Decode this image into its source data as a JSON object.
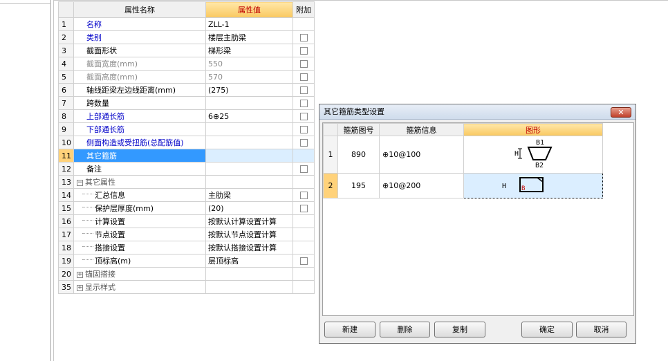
{
  "property_grid": {
    "headers": {
      "index": "",
      "name": "属性名称",
      "value": "属性值",
      "add": "附加"
    },
    "rows": [
      {
        "idx": "1",
        "name": "名称",
        "value": "ZLL-1",
        "check": false,
        "style": "blue"
      },
      {
        "idx": "2",
        "name": "类别",
        "value": "楼层主肋梁",
        "check": true,
        "style": "blue"
      },
      {
        "idx": "3",
        "name": "截面形状",
        "value": "梯形梁",
        "check": true,
        "style": "normal"
      },
      {
        "idx": "4",
        "name": "截面宽度(mm)",
        "value": "550",
        "check": true,
        "style": "gray"
      },
      {
        "idx": "5",
        "name": "截面高度(mm)",
        "value": "570",
        "check": true,
        "style": "gray"
      },
      {
        "idx": "6",
        "name": "轴线距梁左边线距离(mm)",
        "value": "(275)",
        "check": true,
        "style": "normal"
      },
      {
        "idx": "7",
        "name": "跨数量",
        "value": "",
        "check": true,
        "style": "normal"
      },
      {
        "idx": "8",
        "name": "上部通长筋",
        "value": "6⊕25",
        "check": true,
        "style": "blue"
      },
      {
        "idx": "9",
        "name": "下部通长筋",
        "value": "",
        "check": true,
        "style": "blue"
      },
      {
        "idx": "10",
        "name": "侧面构造或受扭筋(总配筋值)",
        "value": "",
        "check": true,
        "style": "blue"
      },
      {
        "idx": "11",
        "name": "其它箍筋",
        "value": "",
        "check": false,
        "style": "sel"
      },
      {
        "idx": "12",
        "name": "备注",
        "value": "",
        "check": true,
        "style": "normal"
      },
      {
        "idx": "13",
        "name": "其它属性",
        "value": "",
        "check": false,
        "style": "group",
        "expander": "−"
      },
      {
        "idx": "14",
        "name": "汇总信息",
        "value": "主肋梁",
        "check": true,
        "style": "child"
      },
      {
        "idx": "15",
        "name": "保护层厚度(mm)",
        "value": "(20)",
        "check": true,
        "style": "child"
      },
      {
        "idx": "16",
        "name": "计算设置",
        "value": "按默认计算设置计算",
        "check": false,
        "style": "child"
      },
      {
        "idx": "17",
        "name": "节点设置",
        "value": "按默认节点设置计算",
        "check": false,
        "style": "child"
      },
      {
        "idx": "18",
        "name": "搭接设置",
        "value": "按默认搭接设置计算",
        "check": false,
        "style": "child"
      },
      {
        "idx": "19",
        "name": "顶标高(m)",
        "value": "层顶标高",
        "check": true,
        "style": "child"
      },
      {
        "idx": "20",
        "name": "锚固搭接",
        "value": "",
        "check": false,
        "style": "group",
        "expander": "+"
      },
      {
        "idx": "35",
        "name": "显示样式",
        "value": "",
        "check": false,
        "style": "group",
        "expander": "+"
      }
    ]
  },
  "dialog": {
    "title": "其它箍筋类型设置",
    "close_label": "✕",
    "headers": {
      "index": "",
      "code": "箍筋图号",
      "info": "箍筋信息",
      "shape": "图形"
    },
    "rows": [
      {
        "idx": "1",
        "code": "890",
        "info": "⊕10@100",
        "labels": {
          "h": "H",
          "b1": "B1",
          "b2": "B2"
        }
      },
      {
        "idx": "2",
        "code": "195",
        "info": "⊕10@200",
        "labels": {
          "h": "H",
          "b": "B"
        }
      }
    ],
    "buttons": {
      "new": "新建",
      "delete": "删除",
      "copy": "复制",
      "ok": "确定",
      "cancel": "取消"
    }
  },
  "colors": {
    "value_header_text": "#c00000",
    "link_blue": "#0000c8",
    "selection_blue": "#3399ff",
    "selection_index": "#ffd27a",
    "shape_red": "#c00000"
  }
}
